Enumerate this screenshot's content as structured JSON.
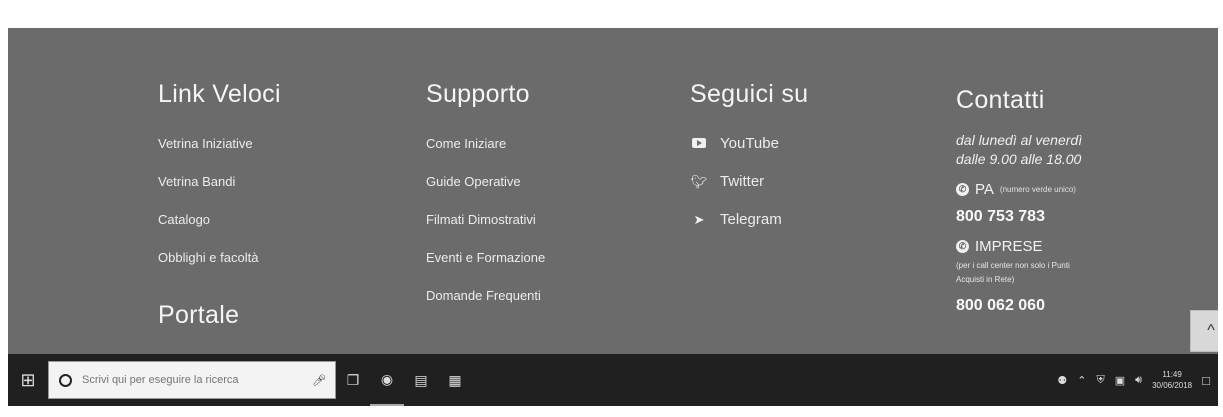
{
  "footer": {
    "link_veloci": {
      "title": "Link Veloci",
      "items": [
        "Vetrina Iniziative",
        "Vetrina Bandi",
        "Catalogo",
        "Obblighi e facoltà"
      ]
    },
    "portale": {
      "title": "Portale"
    },
    "supporto": {
      "title": "Supporto",
      "items": [
        "Come Iniziare",
        "Guide Operative",
        "Filmati Dimostrativi",
        "Eventi e Formazione",
        "Domande Frequenti"
      ]
    },
    "seguici": {
      "title": "Seguici su",
      "items": [
        {
          "label": "YouTube",
          "icon": "youtube-icon"
        },
        {
          "label": "Twitter",
          "icon": "twitter-icon"
        },
        {
          "label": "Telegram",
          "icon": "telegram-icon"
        }
      ]
    },
    "contatti": {
      "title": "Contatti",
      "hours_line1": "dal lunedì al venerdì",
      "hours_line2": "dalle 9.00 alle 18.00",
      "pa_label": "PA",
      "pa_note": "(numero verde unico)",
      "pa_phone": "800 753 783",
      "imprese_label": "IMPRESE",
      "imprese_note1": "(per i call center non solo i Punti",
      "imprese_note2": "Acquisti in Rete)",
      "imprese_phone": "800 062 060"
    },
    "back_to_top": "^"
  },
  "taskbar": {
    "search_placeholder": "Scrivi qui per eseguire la ricerca",
    "time": "11:49",
    "date": "30/06/2018"
  }
}
